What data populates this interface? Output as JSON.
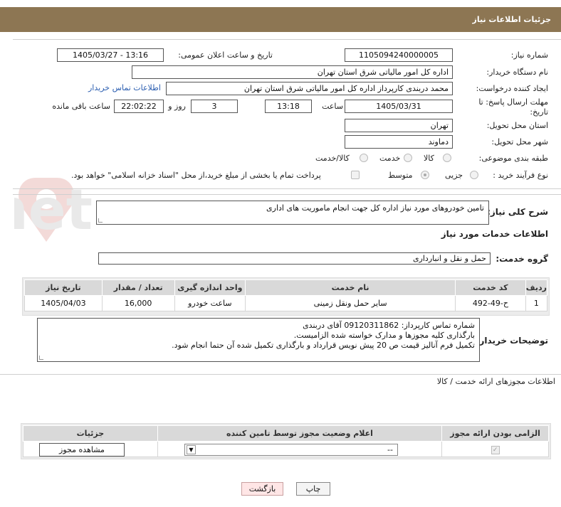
{
  "header": {
    "title": "جزئیات اطلاعات نیاز"
  },
  "fields": {
    "need_number": {
      "label": "شماره نیاز:",
      "value": "1105094240000005"
    },
    "announce_datetime": {
      "label": "تاریخ و ساعت اعلان عمومی:",
      "value": "1405/03/27 - 13:16"
    },
    "buyer_org": {
      "label": "نام دستگاه خریدار:",
      "value": "اداره کل امور مالیاتی شرق استان تهران"
    },
    "creator": {
      "label": "ایجاد کننده درخواست:",
      "value": "محمد دربندی کارپرداز اداره کل امور مالیاتی شرق استان تهران"
    },
    "contact_link": "اطلاعات تماس خریدار",
    "deadline": {
      "label": "مهلت ارسال پاسخ: تا تاریخ:",
      "date": "1405/03/31",
      "time_label": "ساعت",
      "time": "13:18",
      "days": "3",
      "days_label": "روز و",
      "remaining": "22:02:22",
      "remaining_label": "ساعت باقی مانده"
    },
    "province": {
      "label": "استان محل تحویل:",
      "value": "تهران"
    },
    "city": {
      "label": "شهر محل تحویل:",
      "value": "دماوند"
    },
    "category": {
      "label": "طبقه بندی موضوعی:",
      "options": [
        "کالا",
        "خدمت",
        "کالا/خدمت"
      ]
    },
    "process": {
      "label": "نوع فرآیند خرید :",
      "options": [
        "جزیی",
        "متوسط"
      ],
      "payment_note": "پرداخت تمام یا بخشی از مبلغ خرید،از محل \"اسناد خزانه اسلامی\" خواهد بود."
    }
  },
  "summary": {
    "label": "شرح کلی نیاز:",
    "value": "تامین خودروهای مورد نیاز اداره کل جهت انجام ماموریت های اداری"
  },
  "services_title": "اطلاعات خدمات مورد نیاز",
  "service_group": {
    "label": "گروه خدمت:",
    "value": "حمل و نقل و انبارداری"
  },
  "services_table": {
    "headers": [
      "ردیف",
      "کد خدمت",
      "نام خدمت",
      "واحد اندازه گیری",
      "تعداد / مقدار",
      "تاریخ نیاز"
    ],
    "rows": [
      [
        "1",
        "ح-49-492",
        "سایر حمل ونقل زمینی",
        "ساعت خودرو",
        "16,000",
        "1405/04/03"
      ]
    ]
  },
  "buyer_notes": {
    "label": "توضیحات خریدار:",
    "lines": [
      "شماره تماس کارپرداز: 09120311862 آقای دربندی",
      "بارگذاری کلیه مجوزها و مدارک خواسته شده الزامیست.",
      "تکمیل فرم آنالیز قیمت ص 20 پیش نویس قرارداد و بارگذاری تکمیل شده آن حتما انجام شود."
    ]
  },
  "permits": {
    "title": "اطلاعات مجوزهای ارائه خدمت / کالا",
    "headers": [
      "الزامی بودن ارائه مجوز",
      "اعلام وضعیت مجوز توسط تامین کننده",
      "جزئیات"
    ],
    "select_value": "--",
    "view_button": "مشاهده مجوز"
  },
  "actions": {
    "print": "چاپ",
    "back": "بازگشت"
  },
  "watermark_text": "AriaTender.net"
}
